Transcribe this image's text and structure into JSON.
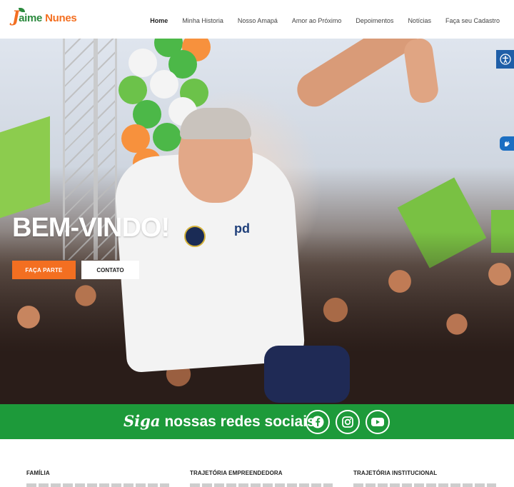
{
  "header": {
    "logo": {
      "initial": "J",
      "first": "aime",
      "last": "Nunes"
    },
    "nav": [
      {
        "label": "Home",
        "active": true
      },
      {
        "label": "Minha Historia"
      },
      {
        "label": "Nosso Amapá"
      },
      {
        "label": "Amor ao Próximo"
      },
      {
        "label": "Depoimentos"
      },
      {
        "label": "Notícias"
      },
      {
        "label": "Faça seu Cadastro"
      }
    ]
  },
  "hero": {
    "headline": "BEM-VINDO!",
    "primary_button": "FAÇA PARTE",
    "secondary_button": "CONTATO",
    "shirt_logo": "pd"
  },
  "social": {
    "title_script": "Siga",
    "title_rest": "nossas redes sociais",
    "icons": [
      "facebook-icon",
      "instagram-icon",
      "youtube-icon"
    ]
  },
  "sections": [
    {
      "title": "FAMÍLIA"
    },
    {
      "title": "TRAJETÓRIA EMPREENDEDORA"
    },
    {
      "title": "TRAJETÓRIA INSTITUCIONAL"
    }
  ],
  "colors": {
    "brand_orange": "#f36f21",
    "brand_green": "#1d9a3a",
    "accessibility_blue": "#1f5fa8"
  }
}
